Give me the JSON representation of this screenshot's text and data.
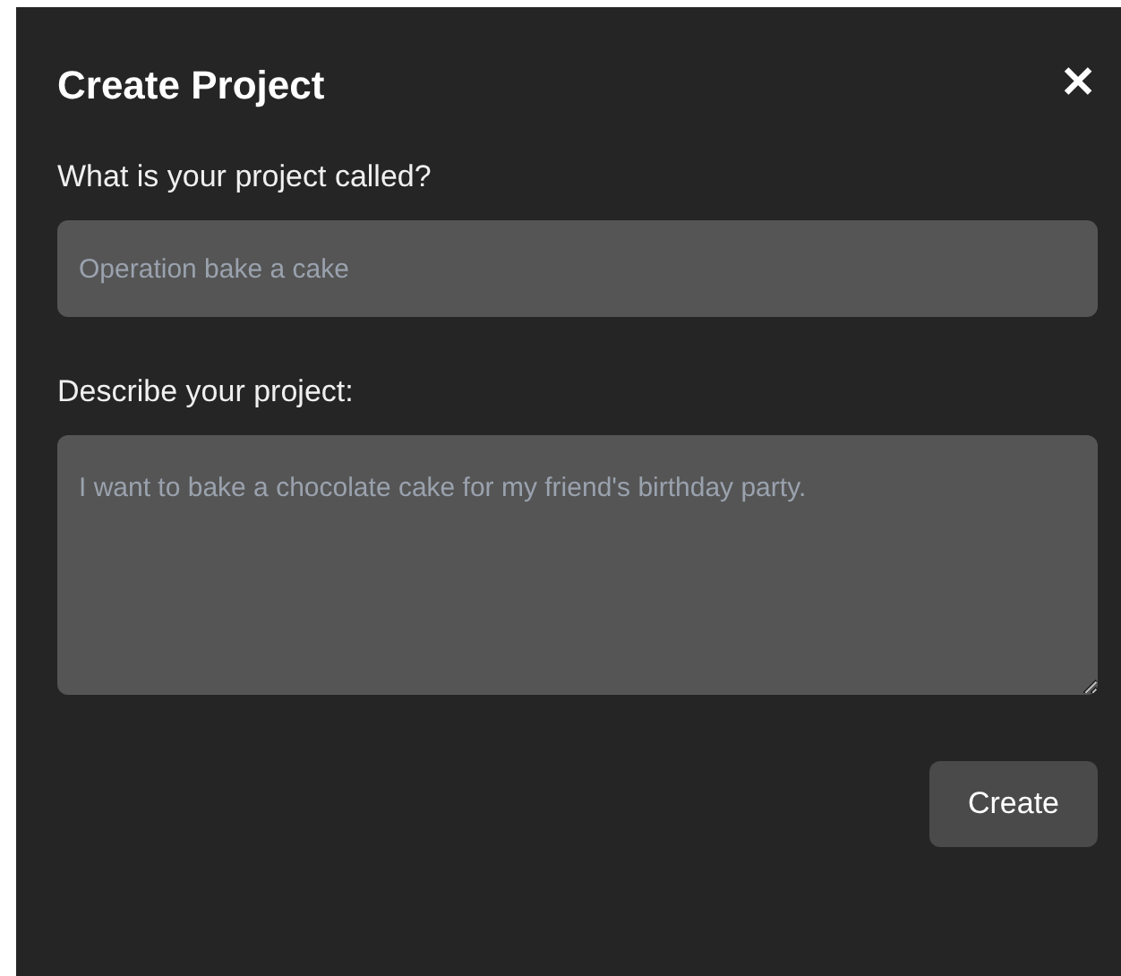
{
  "dialog": {
    "title": "Create Project",
    "close_label": "✕"
  },
  "fields": [
    {
      "kind": "input",
      "label": "What is your project called?",
      "placeholder": "Operation bake a cake"
    },
    {
      "kind": "textarea",
      "label": "Describe your project:",
      "placeholder": "I want to bake a chocolate cake for my friend's birthday party."
    }
  ],
  "buttons": [
    "Create"
  ]
}
